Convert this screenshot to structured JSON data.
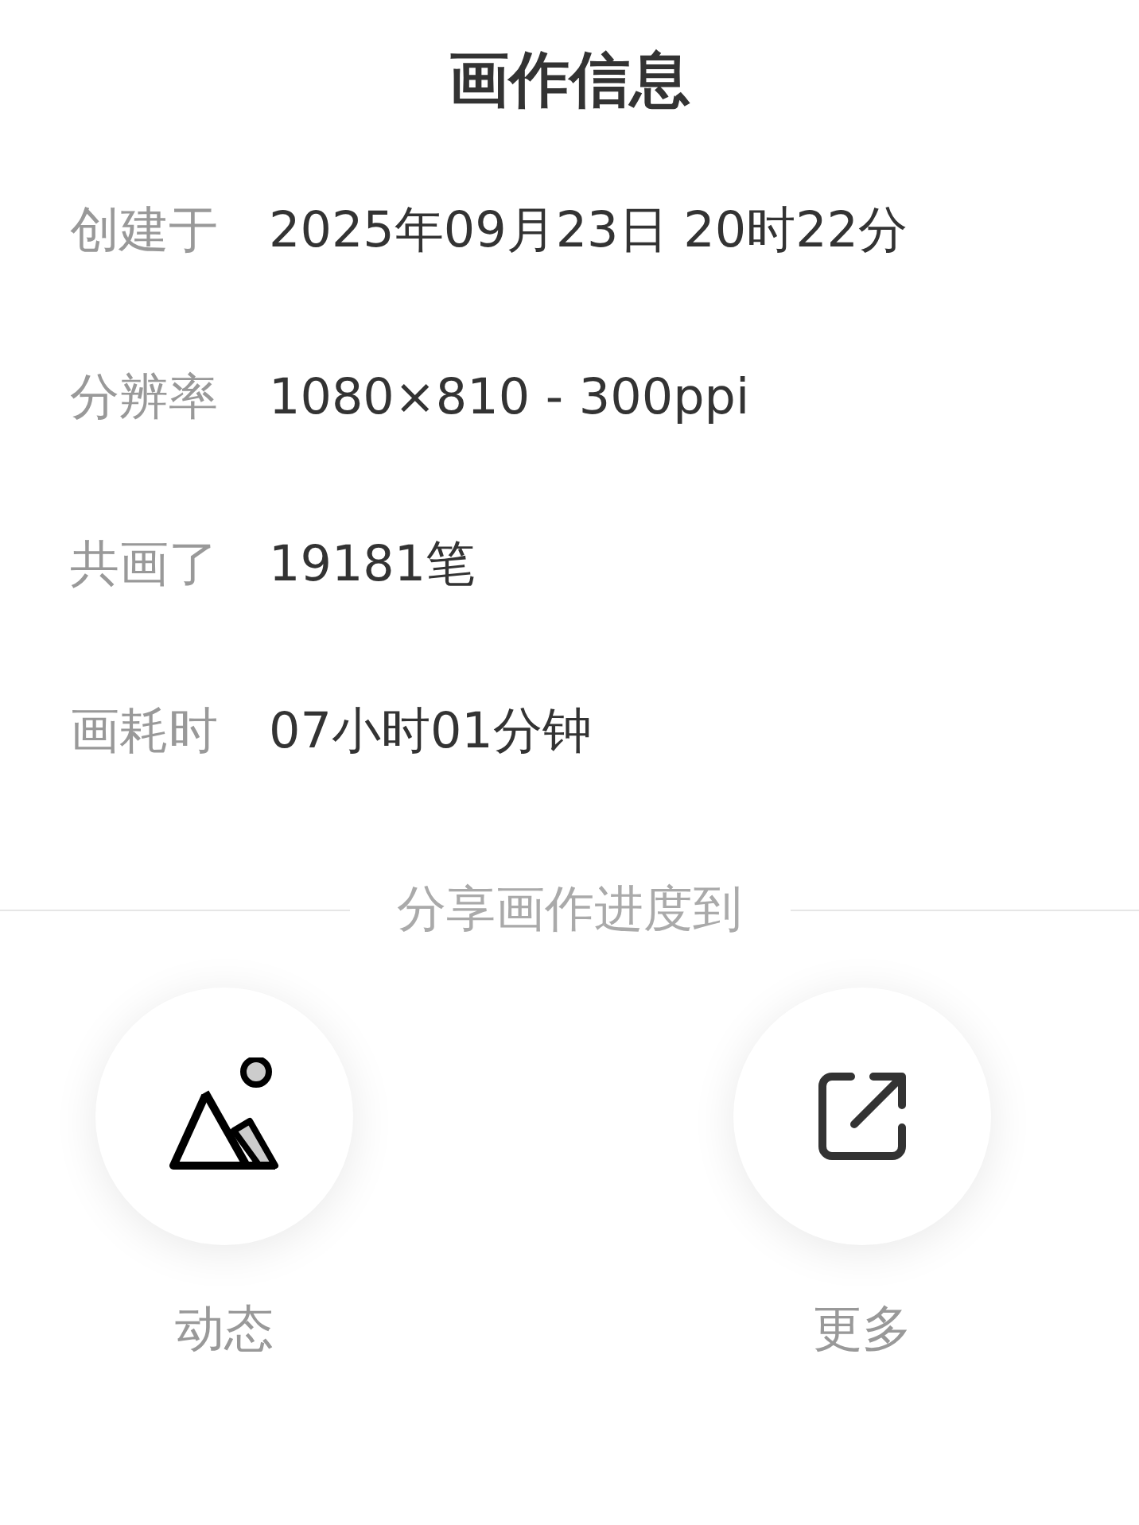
{
  "title": "画作信息",
  "info_rows": [
    {
      "label": "创建于",
      "value": "2025年09月23日 20时22分"
    },
    {
      "label": "分辨率",
      "value": "1080×810 - 300ppi"
    },
    {
      "label": "共画了",
      "value": "19181笔"
    },
    {
      "label": "画耗时",
      "value": "07小时01分钟"
    }
  ],
  "share_heading": "分享画作进度到",
  "share_targets": [
    {
      "kind": "moments",
      "label": "动态"
    },
    {
      "kind": "more",
      "label": "更多"
    }
  ]
}
